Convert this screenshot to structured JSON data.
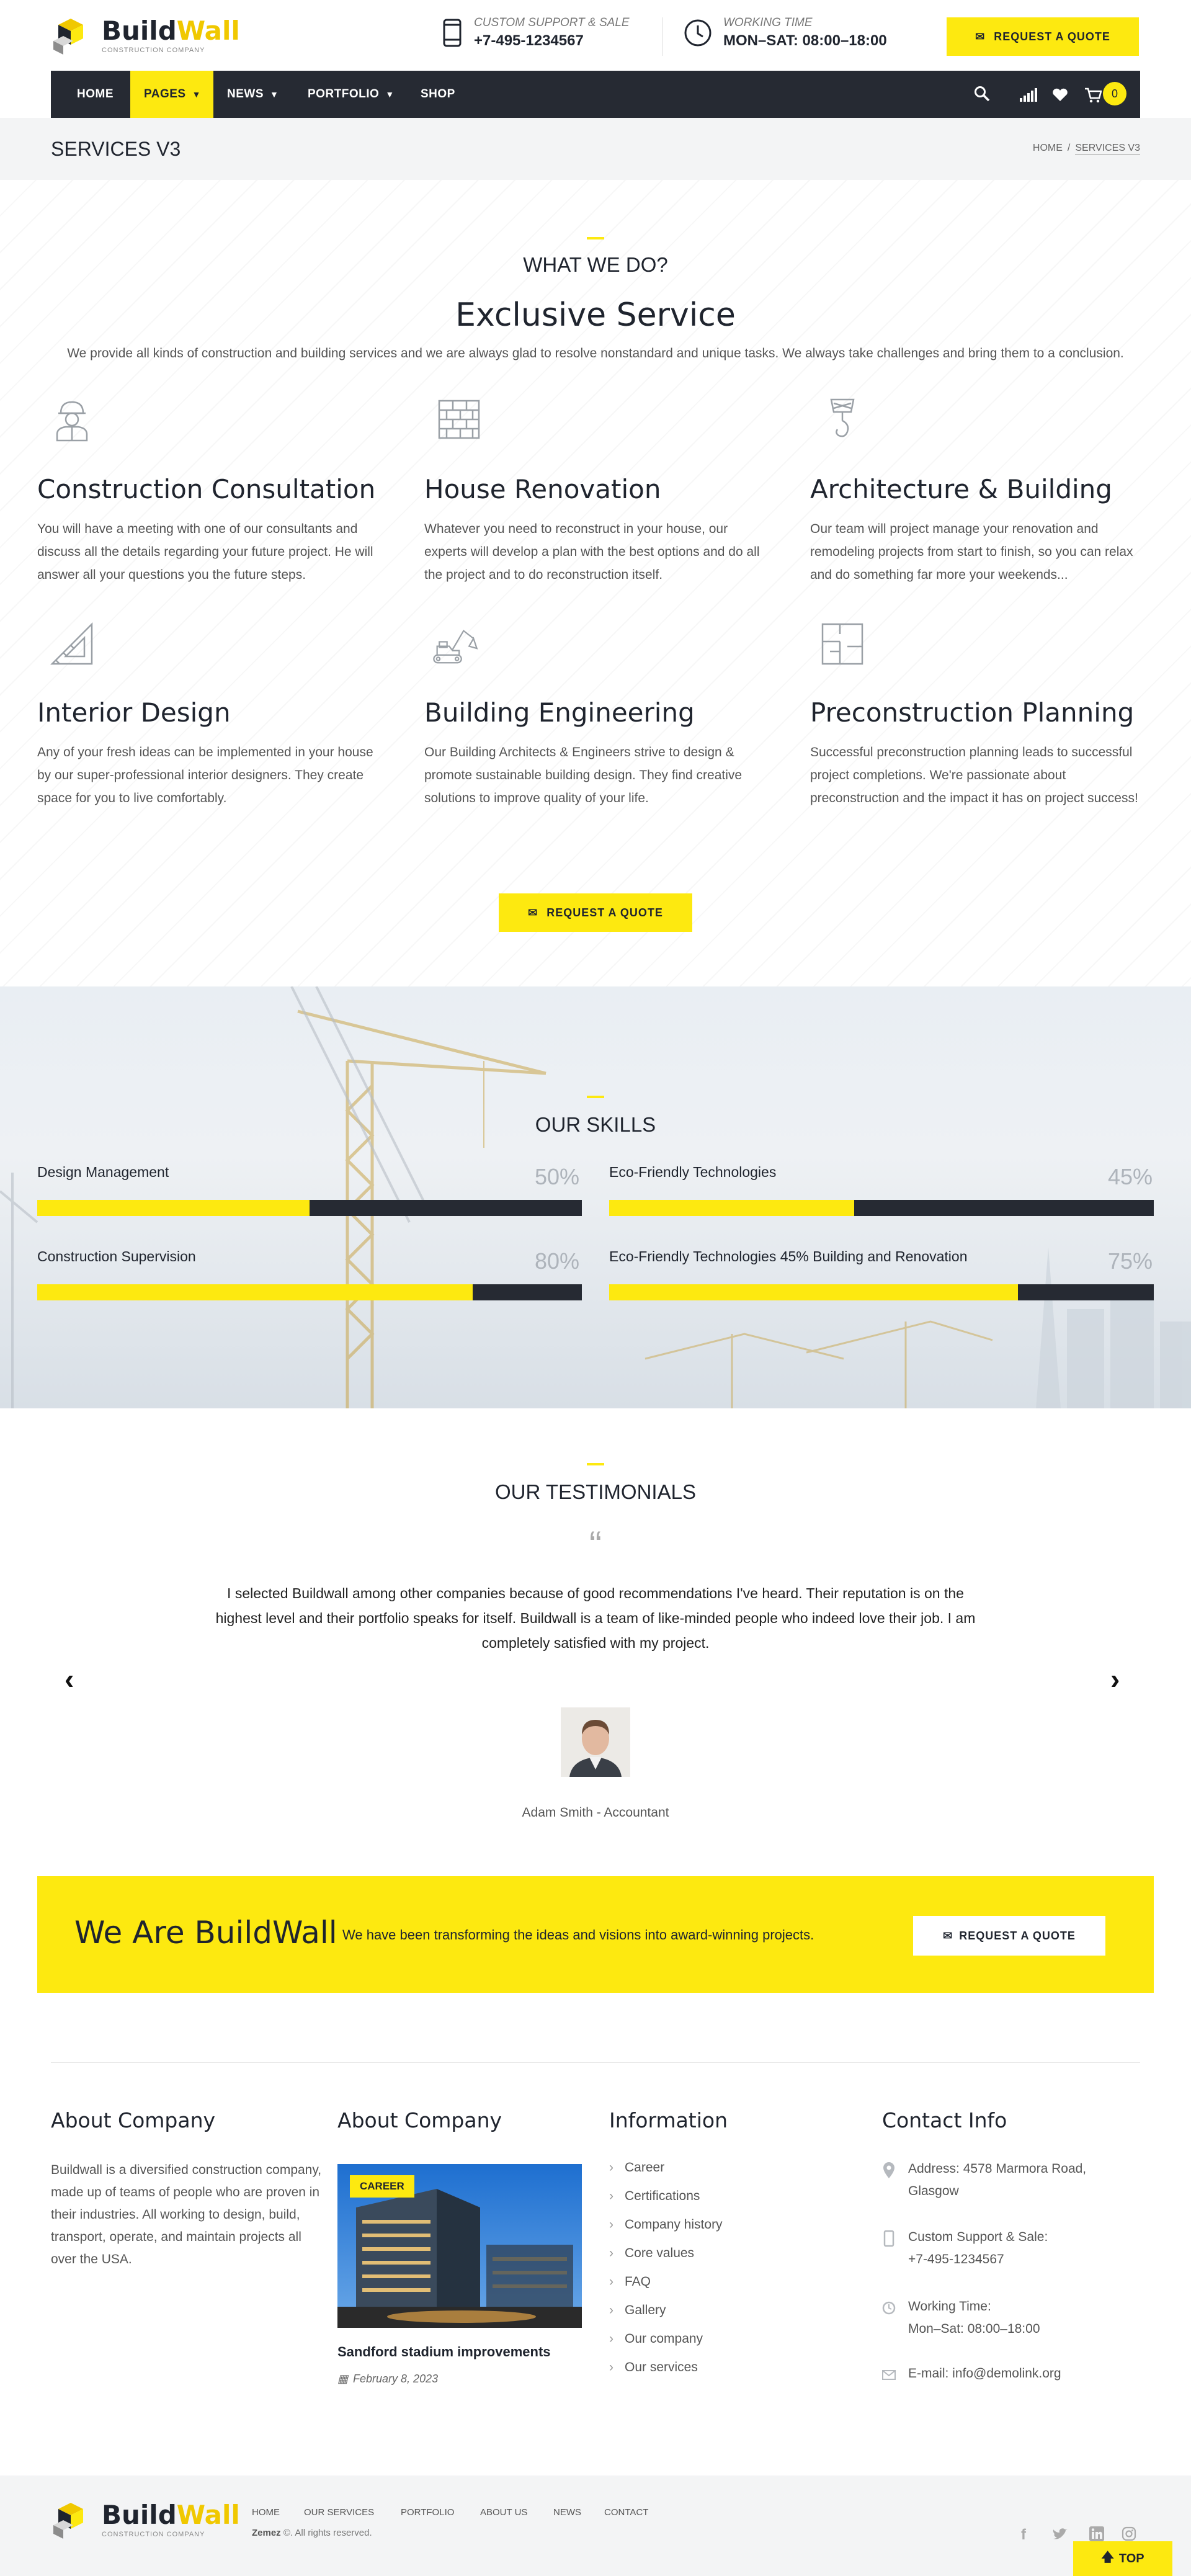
{
  "header": {
    "brand": {
      "part1": "Build",
      "part2": "Wall",
      "tagline": "Construction Company"
    },
    "support": {
      "label": "Custom Support & Sale",
      "value": "+7-495-1234567"
    },
    "hours": {
      "label": "Working Time",
      "value": "MON–SAT: 08:00–18:00"
    },
    "quote_button": "Request a Quote"
  },
  "nav": {
    "items": [
      {
        "label": "HOME",
        "dropdown": false
      },
      {
        "label": "PAGES",
        "dropdown": true,
        "active": true
      },
      {
        "label": "NEWS",
        "dropdown": true
      },
      {
        "label": "PORTFOLIO",
        "dropdown": true
      },
      {
        "label": "SHOP",
        "dropdown": false
      }
    ],
    "cart_count": "0",
    "icons": [
      "search-icon",
      "signal-icon",
      "heart-icon",
      "cart-icon"
    ]
  },
  "page": {
    "title": "SERVICES V3",
    "breadcrumb": {
      "home": "HOME",
      "separator": "/",
      "current": "SERVICES V3"
    }
  },
  "services": {
    "kicker": "WHAT WE DO?",
    "heading": "Exclusive Service",
    "intro": "We provide all kinds of construction and building services and we are always glad to resolve nonstandard and unique tasks. We always take challenges and bring them to a conclusion.",
    "items": [
      {
        "icon": "worker-icon",
        "title": "Construction Consultation",
        "text": "You will have a meeting with one of our consultants and discuss all the details regarding your future project. He will answer all your questions you the future steps."
      },
      {
        "icon": "brick-wall-icon",
        "title": "House Renovation",
        "text": "Whatever you need to reconstruct in your house, our experts will develop a plan with the best options and do all the project and to do reconstruction itself."
      },
      {
        "icon": "crane-hook-icon",
        "title": "Architecture & Building",
        "text": "Our team will project manage your renovation and remodeling projects from start to finish, so you can relax and do something far more your weekends..."
      },
      {
        "icon": "set-square-icon",
        "title": "Interior Design",
        "text": "Any of your fresh ideas can be implemented in your house by our super-professional interior designers. They create space for you to live comfortably."
      },
      {
        "icon": "excavator-icon",
        "title": "Building Engineering",
        "text": "Our Building Architects & Engineers strive to design & promote sustainable building design. They find creative solutions to improve quality of your life."
      },
      {
        "icon": "floor-plan-icon",
        "title": "Preconstruction Planning",
        "text": "Successful preconstruction planning leads to successful project completions. We're passionate about preconstruction and the impact it has on project success!"
      }
    ],
    "quote_button": "Request a Quote"
  },
  "skills": {
    "heading": "OUR SKILLS",
    "items": [
      {
        "label": "Design Management",
        "percent_text": "50%",
        "value": 50
      },
      {
        "label": "Eco-Friendly Technologies",
        "percent_text": "45%",
        "value": 45
      },
      {
        "label": "Construction Supervision",
        "percent_text": "80%",
        "value": 80
      },
      {
        "label": "Eco-Friendly Technologies 45% Building and Renovation",
        "percent_text": "75%",
        "value": 75
      }
    ]
  },
  "testimonials": {
    "heading": "OUR TESTIMONIALS",
    "quote_mark": "“",
    "quote": "I selected Buildwall among other companies because of good recommendations I've heard. Their reputation is on the highest level and their portfolio speaks for itself. Buildwall is a team of like-minded people who indeed love their job. I am completely satisfied with my project.",
    "author": "Adam Smith - Accountant",
    "prev": "‹",
    "next": "›"
  },
  "cta": {
    "heading": "We Are BuildWall",
    "text": "We have been transforming the ideas and visions into award-winning projects.",
    "button": "Request a Quote"
  },
  "footer": {
    "about": {
      "title": "About Company",
      "text": "Buildwall is a diversified construction company, made up of teams of people who are proven in their industries. All working to design, build, transport, operate, and maintain projects all over the USA."
    },
    "post": {
      "title": "About Company",
      "badge": "CAREER",
      "post_title": "Sandford stadium improvements",
      "date": "February 8, 2023"
    },
    "information": {
      "title": "Information",
      "links": [
        "Career",
        "Certifications",
        "Company history",
        "Core values",
        "FAQ",
        "Gallery",
        "Our company",
        "Our services"
      ]
    },
    "contact": {
      "title": "Contact Info",
      "address_line1": "Address: 4578 Marmora Road,",
      "address_line2": "Glasgow",
      "support_line1": "Custom Support & Sale:",
      "support_line2": "+7-495-1234567",
      "hours_line1": "Working Time:",
      "hours_line2": "Mon–Sat: 08:00–18:00",
      "email": "E-mail: info@demolink.org"
    }
  },
  "bottom": {
    "links": [
      "HOME",
      "OUR SERVICES",
      "PORTFOLIO",
      "ABOUT US",
      "NEWS",
      "CONTACT"
    ],
    "copyright_brand": "Zemez",
    "copyright_rest": "©. All rights reserved.",
    "social": [
      "facebook-icon",
      "twitter-icon",
      "linkedin-icon",
      "instagram-icon"
    ],
    "top_button": "TOP"
  },
  "colors": {
    "accent": "#fde910",
    "dark": "#262a33",
    "muted": "#555555"
  }
}
